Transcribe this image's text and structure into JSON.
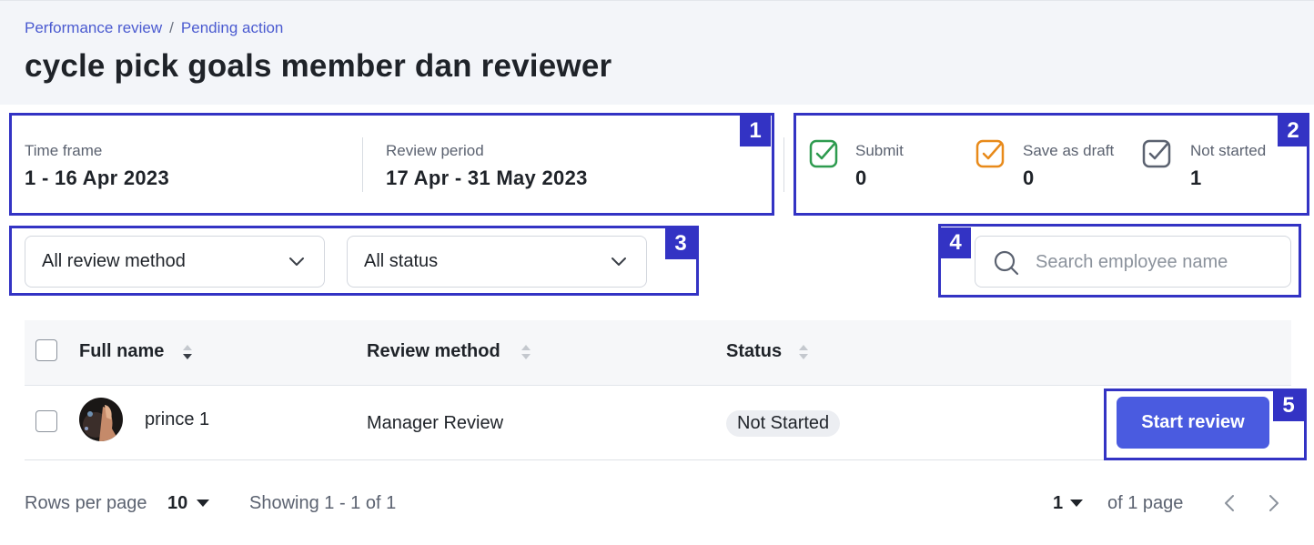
{
  "breadcrumb": {
    "root": "Performance review",
    "separator": "/",
    "current": "Pending action"
  },
  "page_title": "cycle pick goals member dan reviewer",
  "info": {
    "time_frame_label": "Time frame",
    "time_frame_value": "1 - 16 Apr 2023",
    "review_period_label": "Review period",
    "review_period_value": "17 Apr - 31 May 2023"
  },
  "status_summary": [
    {
      "label": "Submit",
      "count": "0",
      "color": "#2e9b4f",
      "icon": "check-square-icon"
    },
    {
      "label": "Save as draft",
      "count": "0",
      "color": "#e88a1a",
      "icon": "check-square-icon"
    },
    {
      "label": "Not started",
      "count": "1",
      "color": "#5b6270",
      "icon": "check-square-icon"
    }
  ],
  "filters": {
    "review_method": "All review method",
    "status": "All status"
  },
  "search": {
    "placeholder": "Search employee name"
  },
  "table": {
    "columns": [
      "Full name",
      "Review method",
      "Status"
    ],
    "rows": [
      {
        "name": "prince 1",
        "review_method": "Manager Review",
        "status": "Not Started",
        "action": "Start review"
      }
    ]
  },
  "pagination": {
    "rows_per_page_label": "Rows per page",
    "rows_per_page_value": "10",
    "showing": "Showing 1 - 1 of 1",
    "current_page": "1",
    "of_pages": "of 1 page"
  },
  "annotations": [
    "1",
    "2",
    "3",
    "4",
    "5"
  ],
  "colors": {
    "accent": "#4a5be0",
    "annotation": "#3333c4",
    "header_bg": "#f3f5f9"
  }
}
